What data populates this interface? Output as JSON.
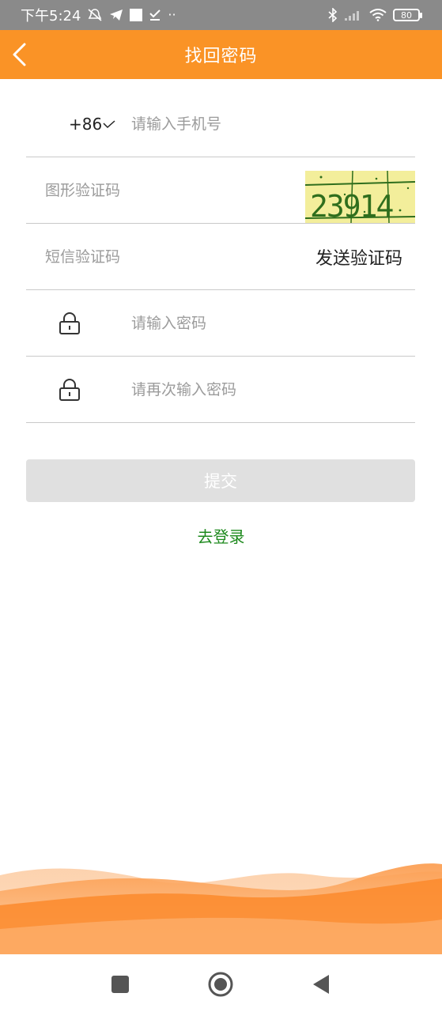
{
  "status_bar": {
    "time": "下午5:24",
    "battery": "80"
  },
  "header": {
    "title": "找回密码"
  },
  "form": {
    "country_code": "+86",
    "phone_placeholder": "请输入手机号",
    "captcha_placeholder": "图形验证码",
    "captcha_text": "23914",
    "sms_placeholder": "短信验证码",
    "send_code_label": "发送验证码",
    "password_placeholder": "请输入密码",
    "confirm_password_placeholder": "请再次输入密码"
  },
  "actions": {
    "submit_label": "提交",
    "login_link": "去登录"
  },
  "colors": {
    "accent": "#fa9326",
    "link": "#1e8a1e",
    "disabled_button": "#e0e0e0"
  }
}
